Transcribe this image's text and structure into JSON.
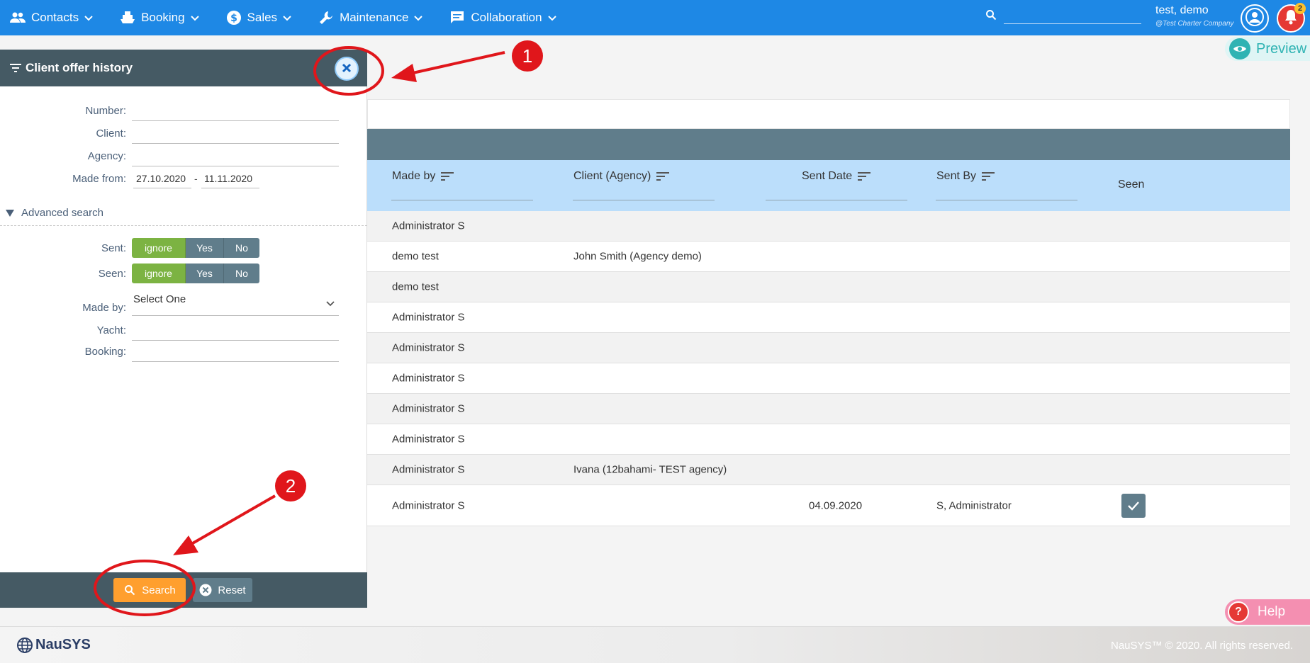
{
  "nav": {
    "items": [
      {
        "label": "Contacts",
        "icon": "people-icon"
      },
      {
        "label": "Booking",
        "icon": "ship-icon"
      },
      {
        "label": "Sales",
        "icon": "dollar-icon"
      },
      {
        "label": "Maintenance",
        "icon": "wrench-icon"
      },
      {
        "label": "Collaboration",
        "icon": "chat-icon"
      }
    ],
    "search_placeholder": "",
    "user_name": "test, demo",
    "user_company": "@Test Charter Company",
    "notification_count": "2"
  },
  "preview_label": "Preview",
  "filter_panel": {
    "title": "Client offer history",
    "number_label": "Number:",
    "client_label": "Client:",
    "agency_label": "Agency:",
    "made_from_label": "Made from:",
    "date_from": "27.10.2020",
    "date_sep": "-",
    "date_to": "11.11.2020",
    "advanced_label": "Advanced search",
    "sent_label": "Sent:",
    "seen_label": "Seen:",
    "toggle_ignore": "ignore",
    "toggle_yes": "Yes",
    "toggle_no": "No",
    "made_by_label": "Made by:",
    "made_by_value": "Select One",
    "yacht_label": "Yacht:",
    "booking_label": "Booking:",
    "search_button": "Search",
    "reset_button": "Reset"
  },
  "table": {
    "columns": [
      "Made by",
      "Client (Agency)",
      "Sent Date",
      "Sent By",
      "Seen"
    ],
    "rows": [
      {
        "made_by": "Administrator S",
        "client": "",
        "sent_date": "",
        "sent_by": "",
        "seen": false
      },
      {
        "made_by": "demo test",
        "client": "John Smith  (Agency demo)",
        "sent_date": "",
        "sent_by": "",
        "seen": false
      },
      {
        "made_by": "demo test",
        "client": "",
        "sent_date": "",
        "sent_by": "",
        "seen": false
      },
      {
        "made_by": "Administrator S",
        "client": "",
        "sent_date": "",
        "sent_by": "",
        "seen": false
      },
      {
        "made_by": "Administrator S",
        "client": "",
        "sent_date": "",
        "sent_by": "",
        "seen": false
      },
      {
        "made_by": "Administrator S",
        "client": "",
        "sent_date": "",
        "sent_by": "",
        "seen": false
      },
      {
        "made_by": "Administrator S",
        "client": "",
        "sent_date": "",
        "sent_by": "",
        "seen": false
      },
      {
        "made_by": "Administrator S",
        "client": "",
        "sent_date": "",
        "sent_by": "",
        "seen": false
      },
      {
        "made_by": "Administrator S",
        "client": "Ivana  (12bahami- TEST agency)",
        "sent_date": "",
        "sent_by": "",
        "seen": false
      },
      {
        "made_by": "Administrator S",
        "client": "",
        "sent_date": "04.09.2020",
        "sent_by": "S, Administrator",
        "seen": true
      }
    ]
  },
  "help_label": "Help",
  "footer": {
    "brand": "NauSYS",
    "copyright": "NauSYS™ © 2020. All rights reserved."
  },
  "annotations": {
    "marker_1": "1",
    "marker_2": "2",
    "color": "#e0161b"
  }
}
